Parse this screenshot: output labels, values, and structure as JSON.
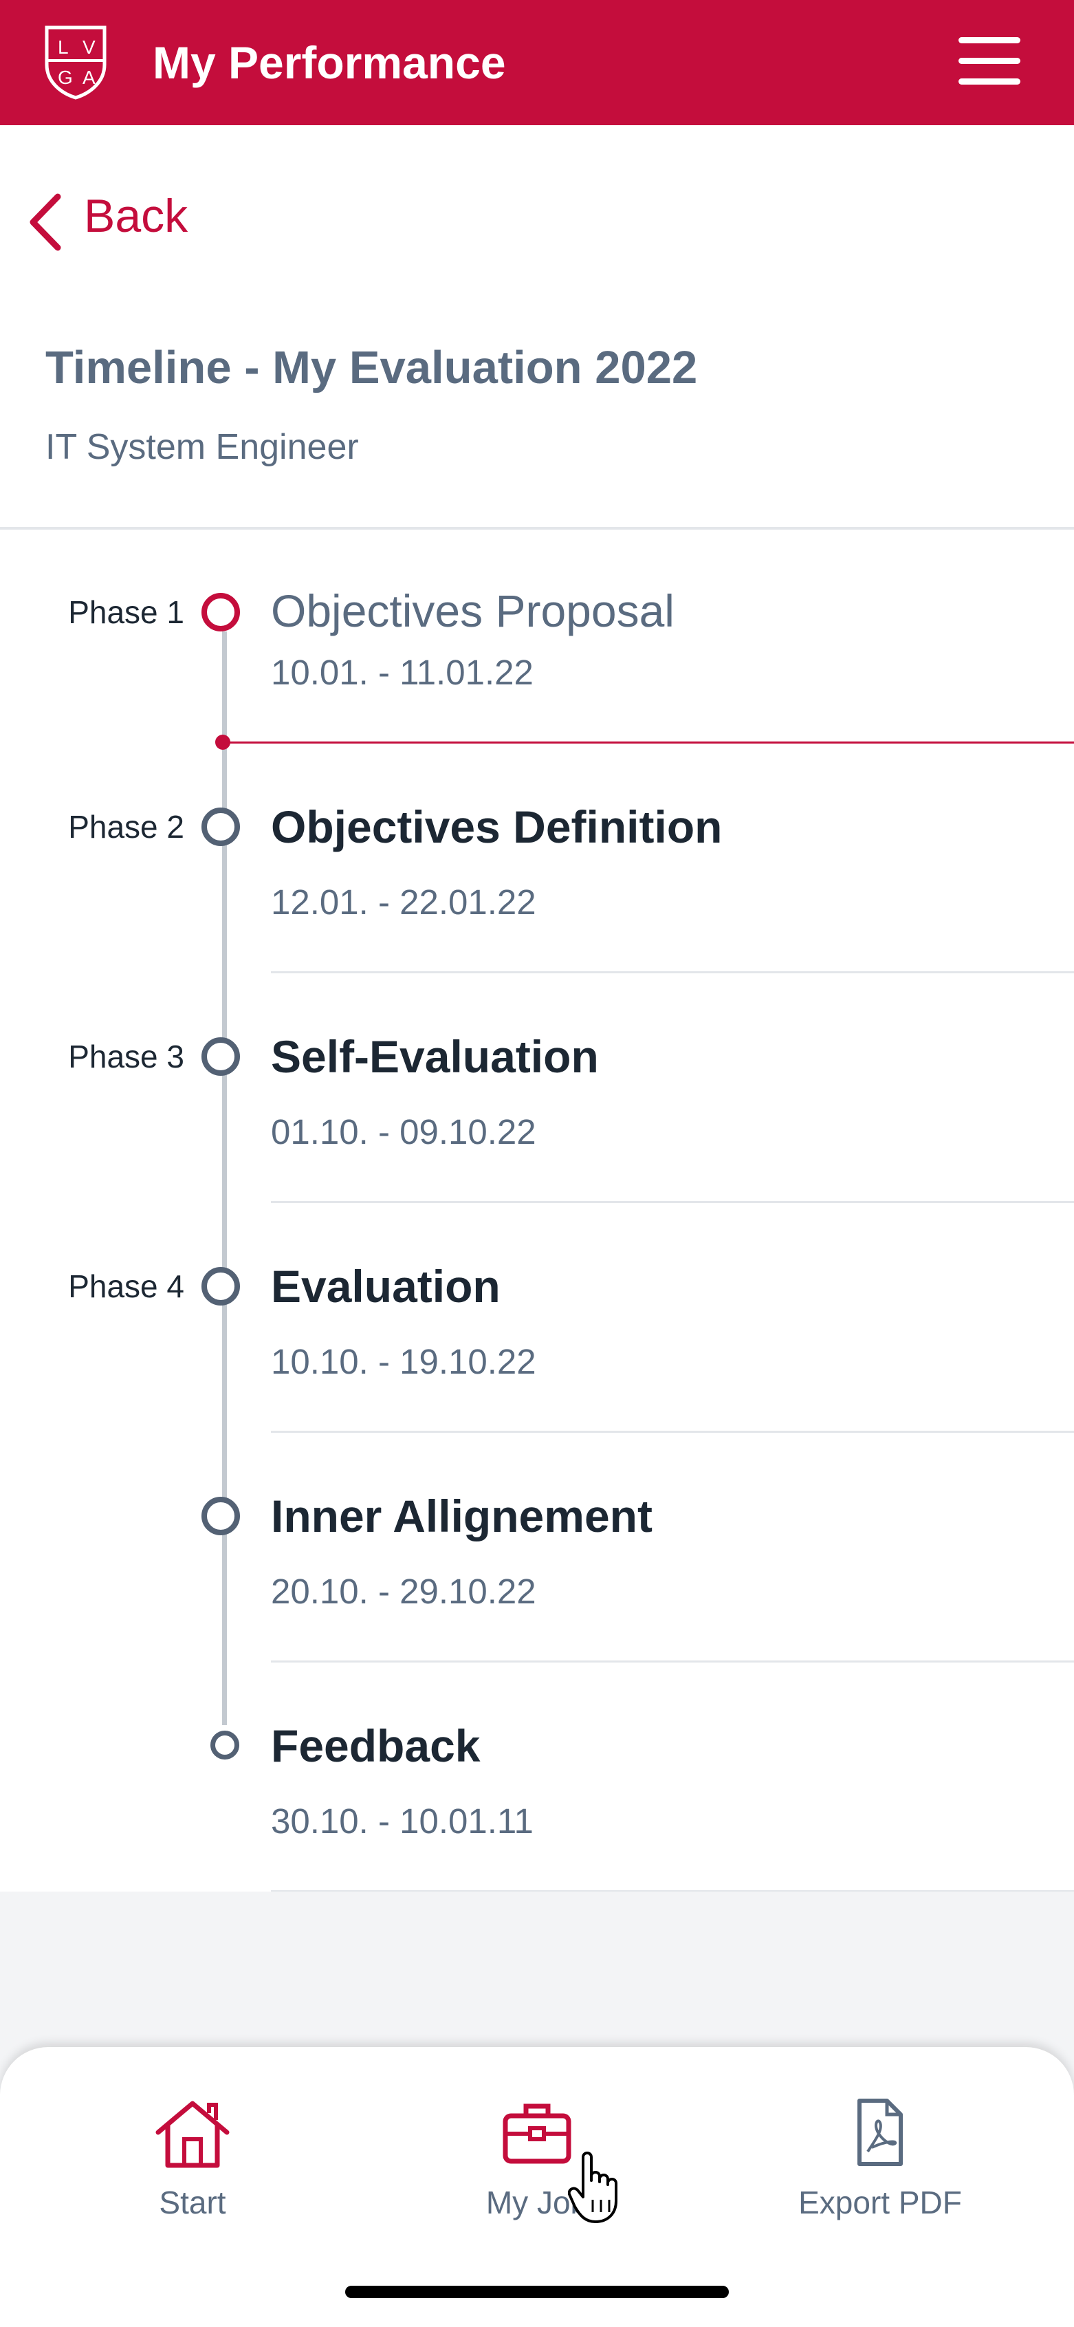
{
  "app": {
    "title": "My Performance",
    "logo_text": "LVGA",
    "menu_icon": "hamburger-menu-icon"
  },
  "nav": {
    "back_label": "Back"
  },
  "page": {
    "title": "Timeline - My Evaluation 2022",
    "subtitle": "IT System Engineer"
  },
  "timeline": [
    {
      "phase": "Phase 1",
      "title": "Objectives Proposal",
      "dates": "10.01. - 11.01.22",
      "status": "current"
    },
    {
      "phase": "Phase 2",
      "title": "Objectives Definition",
      "dates": "12.01. - 22.01.22",
      "status": "upcoming"
    },
    {
      "phase": "Phase 3",
      "title": "Self-Evaluation",
      "dates": "01.10. - 09.10.22",
      "status": "upcoming"
    },
    {
      "phase": "Phase 4",
      "title": "Evaluation",
      "dates": "10.10. - 19.10.22",
      "status": "upcoming"
    },
    {
      "phase": "",
      "title": "Inner Allignement",
      "dates": "20.10. - 29.10.22",
      "status": "upcoming"
    },
    {
      "phase": "",
      "title": "Feedback",
      "dates": "30.10. - 10.01.11",
      "status": "end"
    }
  ],
  "bottom_nav": [
    {
      "label": "Start",
      "icon": "home-icon"
    },
    {
      "label": "My Job",
      "icon": "briefcase-icon"
    },
    {
      "label": "Export PDF",
      "icon": "pdf-file-icon"
    }
  ],
  "colors": {
    "brand": "#c40d3c",
    "text_dark": "#1c2733",
    "text_muted": "#5a6b80",
    "rail": "#c3c9d0"
  }
}
